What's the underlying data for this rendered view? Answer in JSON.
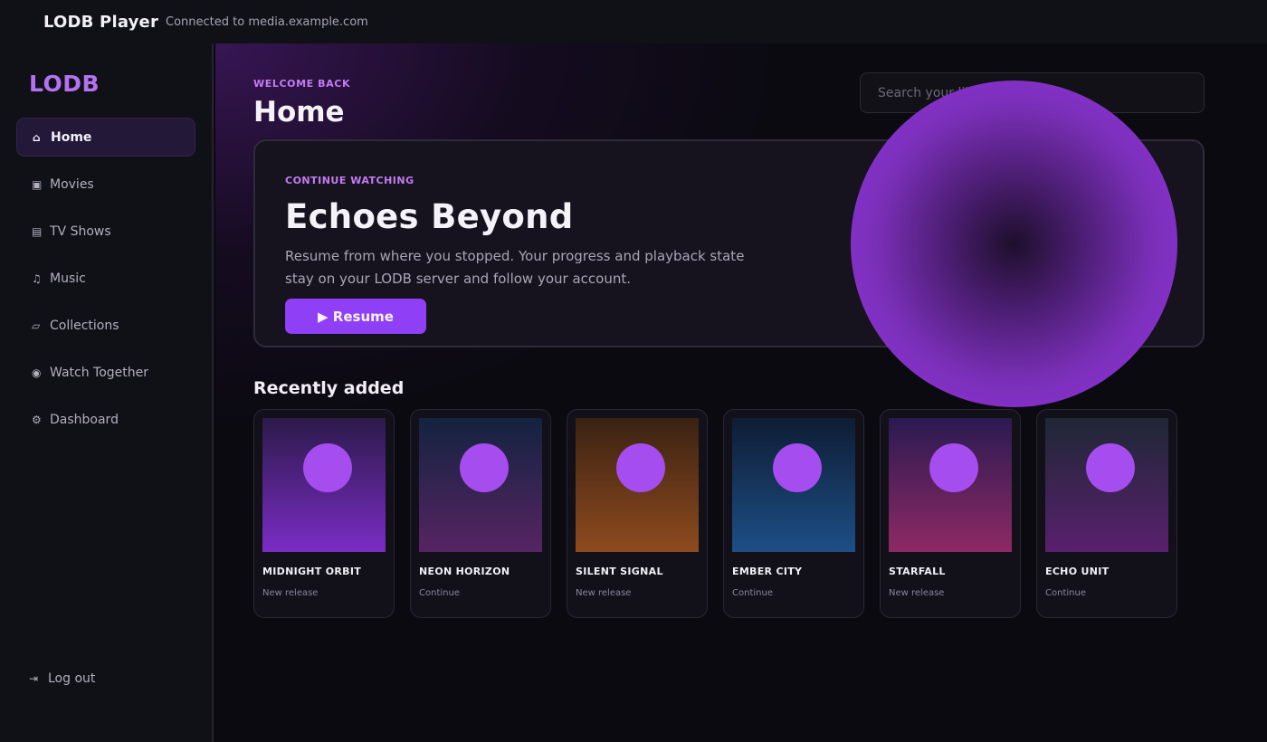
{
  "topbar": {
    "app_title": "LODB Player",
    "connection": "Connected to media.example.com"
  },
  "sidebar": {
    "brand": "LODB",
    "items": [
      {
        "icon": "⌂",
        "icon_name": "home-icon",
        "label": "Home",
        "active": true
      },
      {
        "icon": "▣",
        "icon_name": "movie-icon",
        "label": "Movies"
      },
      {
        "icon": "▤",
        "icon_name": "tv-icon",
        "label": "TV Shows"
      },
      {
        "icon": "♫",
        "icon_name": "music-icon",
        "label": "Music"
      },
      {
        "icon": "▱",
        "icon_name": "collections-icon",
        "label": "Collections"
      },
      {
        "icon": "◉",
        "icon_name": "watch-together-icon",
        "label": "Watch Together"
      },
      {
        "icon": "⚙",
        "icon_name": "gear-icon",
        "label": "Dashboard"
      }
    ],
    "logout": {
      "icon": "⇥",
      "icon_name": "logout-icon",
      "label": "Log out"
    }
  },
  "main": {
    "eyebrow": "WELCOME BACK",
    "title": "Home",
    "search": {
      "placeholder": "Search your library",
      "value": ""
    },
    "hero": {
      "eyebrow": "CONTINUE WATCHING",
      "title": "Echoes Beyond",
      "description": "Resume from where you stopped. Your progress and playback state stay on your LODB server and follow your account.",
      "button_label": "▶ Resume"
    },
    "recent": {
      "title": "Recently added",
      "cards": [
        {
          "title": "MIDNIGHT ORBIT",
          "subtitle": "New release",
          "colors": [
            "#2c1a4a",
            "#7a2cc5"
          ]
        },
        {
          "title": "NEON HORIZON",
          "subtitle": "Continue",
          "colors": [
            "#13233f",
            "#562463"
          ]
        },
        {
          "title": "SILENT SIGNAL",
          "subtitle": "New release",
          "colors": [
            "#3a2212",
            "#8e4a1e"
          ]
        },
        {
          "title": "EMBER CITY",
          "subtitle": "Continue",
          "colors": [
            "#0e1c33",
            "#1d4f86"
          ]
        },
        {
          "title": "STARFALL",
          "subtitle": "New release",
          "colors": [
            "#2a1a52",
            "#8e2963"
          ]
        },
        {
          "title": "ECHO UNIT",
          "subtitle": "Continue",
          "colors": [
            "#1f2735",
            "#59206e"
          ]
        }
      ]
    }
  },
  "colors": {
    "accent": "#8f3ff5",
    "brand": "#b472f0",
    "orb": "#8f34d8"
  }
}
